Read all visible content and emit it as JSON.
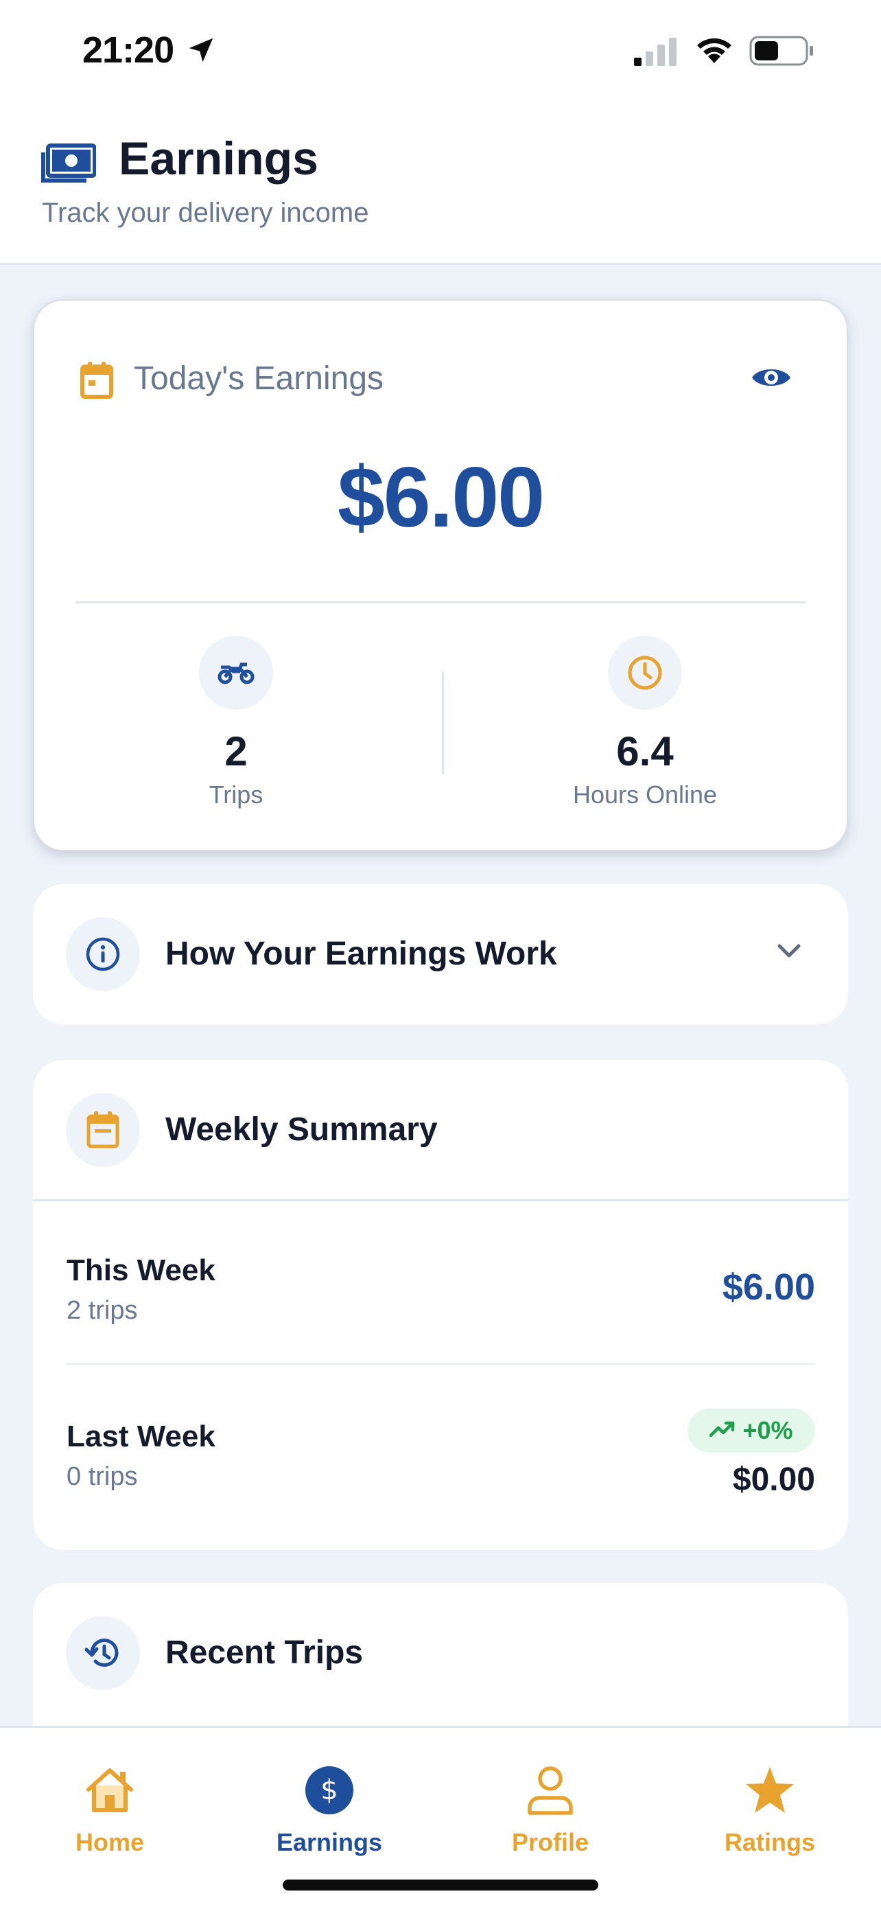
{
  "status_bar": {
    "time": "21:20"
  },
  "header": {
    "title": "Earnings",
    "subtitle": "Track your delivery income"
  },
  "today": {
    "label": "Today's Earnings",
    "amount": "$6.00",
    "trips_value": "2",
    "trips_label": "Trips",
    "hours_value": "6.4",
    "hours_label": "Hours Online"
  },
  "info": {
    "title": "How Your Earnings Work"
  },
  "weekly": {
    "title": "Weekly Summary",
    "this_week": {
      "title": "This Week",
      "trips": "2 trips",
      "amount": "$6.00"
    },
    "last_week": {
      "title": "Last Week",
      "trips": "0 trips",
      "amount": "$0.00",
      "trend": "+0%"
    }
  },
  "recent": {
    "title": "Recent Trips"
  },
  "tabs": [
    {
      "label": "Home",
      "icon": "home-icon"
    },
    {
      "label": "Earnings",
      "icon": "dollar-icon"
    },
    {
      "label": "Profile",
      "icon": "person-icon"
    },
    {
      "label": "Ratings",
      "icon": "star-icon"
    }
  ],
  "colors": {
    "primary": "#1f4e9c",
    "accent": "#e8a32e",
    "success": "#1f9e4a",
    "background": "#eef3fa"
  }
}
